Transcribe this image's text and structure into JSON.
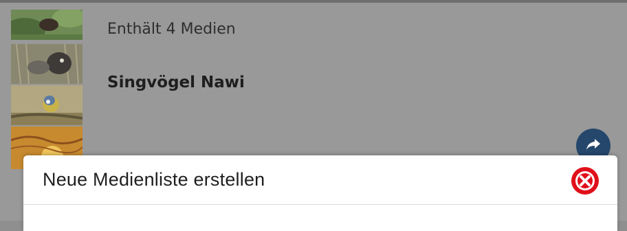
{
  "list_item": {
    "meta": "Enthält 4 Medien",
    "title": "Singvögel Nawi",
    "thumbnails": [
      "bird-thumbnail-1",
      "bird-thumbnail-2",
      "bird-thumbnail-3",
      "bird-thumbnail-4"
    ],
    "share_icon": "share-arrow-icon"
  },
  "modal": {
    "title": "Neue Medienliste erstellen",
    "close_icon": "close-icon"
  },
  "colors": {
    "overlay": "#999999",
    "share_button": "#24476b",
    "close_red": "#e0101a",
    "modal_bg": "#ffffff"
  }
}
